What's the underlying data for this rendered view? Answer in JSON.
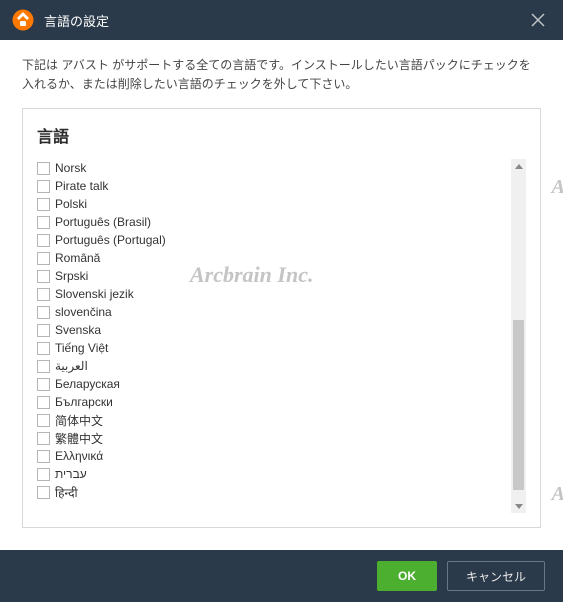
{
  "titlebar": {
    "title": "言語の設定"
  },
  "description": "下記は アバスト がサポートする全ての言語です。インストールしたい言語パックにチェックを入れるか、または削除したい言語のチェックを外して下さい。",
  "panel": {
    "heading": "言語",
    "languages": [
      "Norsk",
      "Pirate talk",
      "Polski",
      "Português (Brasil)",
      "Português (Portugal)",
      "Română",
      "Srpski",
      "Slovenski jezik",
      "slovenčina",
      "Svenska",
      "Tiếng Việt",
      "العربية",
      "Беларуская",
      "Български",
      "简体中文",
      "繁體中文",
      "Ελληνικά",
      "עברית",
      "हिन्दी"
    ]
  },
  "footer": {
    "ok": "OK",
    "cancel": "キャンセル"
  },
  "watermark": {
    "text": "Arcbrain Inc."
  }
}
